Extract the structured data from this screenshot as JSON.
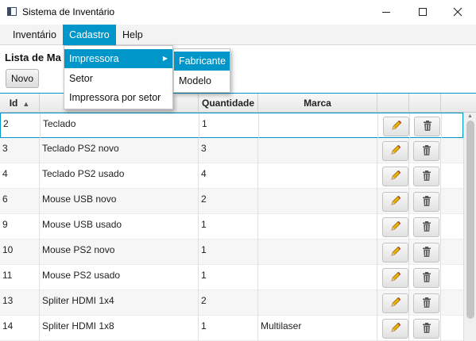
{
  "window": {
    "title": "Sistema de Inventário"
  },
  "menubar": {
    "items": [
      "Inventário",
      "Cadastro",
      "Help"
    ]
  },
  "content": {
    "title": "Lista de Ma",
    "new_button": "Novo"
  },
  "table": {
    "columns": [
      "Id",
      "",
      "Quantidade",
      "Marca",
      "",
      ""
    ],
    "rows": [
      {
        "id": "2",
        "nome": "Teclado",
        "quantidade": "1",
        "marca": ""
      },
      {
        "id": "3",
        "nome": "Teclado PS2 novo",
        "quantidade": "3",
        "marca": ""
      },
      {
        "id": "4",
        "nome": "Teclado PS2 usado",
        "quantidade": "4",
        "marca": ""
      },
      {
        "id": "6",
        "nome": "Mouse USB novo",
        "quantidade": "2",
        "marca": ""
      },
      {
        "id": "9",
        "nome": "Mouse USB usado",
        "quantidade": "1",
        "marca": ""
      },
      {
        "id": "10",
        "nome": "Mouse PS2 novo",
        "quantidade": "1",
        "marca": ""
      },
      {
        "id": "11",
        "nome": "Mouse PS2 usado",
        "quantidade": "1",
        "marca": ""
      },
      {
        "id": "13",
        "nome": "Spliter HDMI 1x4",
        "quantidade": "2",
        "marca": ""
      },
      {
        "id": "14",
        "nome": "Spliter HDMI 1x8",
        "quantidade": "1",
        "marca": "Multilaser"
      }
    ],
    "row_actions": {
      "edit_icon": "pencil-icon",
      "delete_icon": "trash-icon"
    }
  },
  "cadastro_menu": {
    "items": [
      "Impressora",
      "Setor",
      "Impressora por setor"
    ],
    "highlighted": "Impressora"
  },
  "impressora_submenu": {
    "items": [
      "Fabricante",
      "Modelo"
    ],
    "highlighted": "Fabricante"
  },
  "colors": {
    "accent": "#0096c9",
    "pencil": "#f0b400",
    "trash": "#555555"
  }
}
